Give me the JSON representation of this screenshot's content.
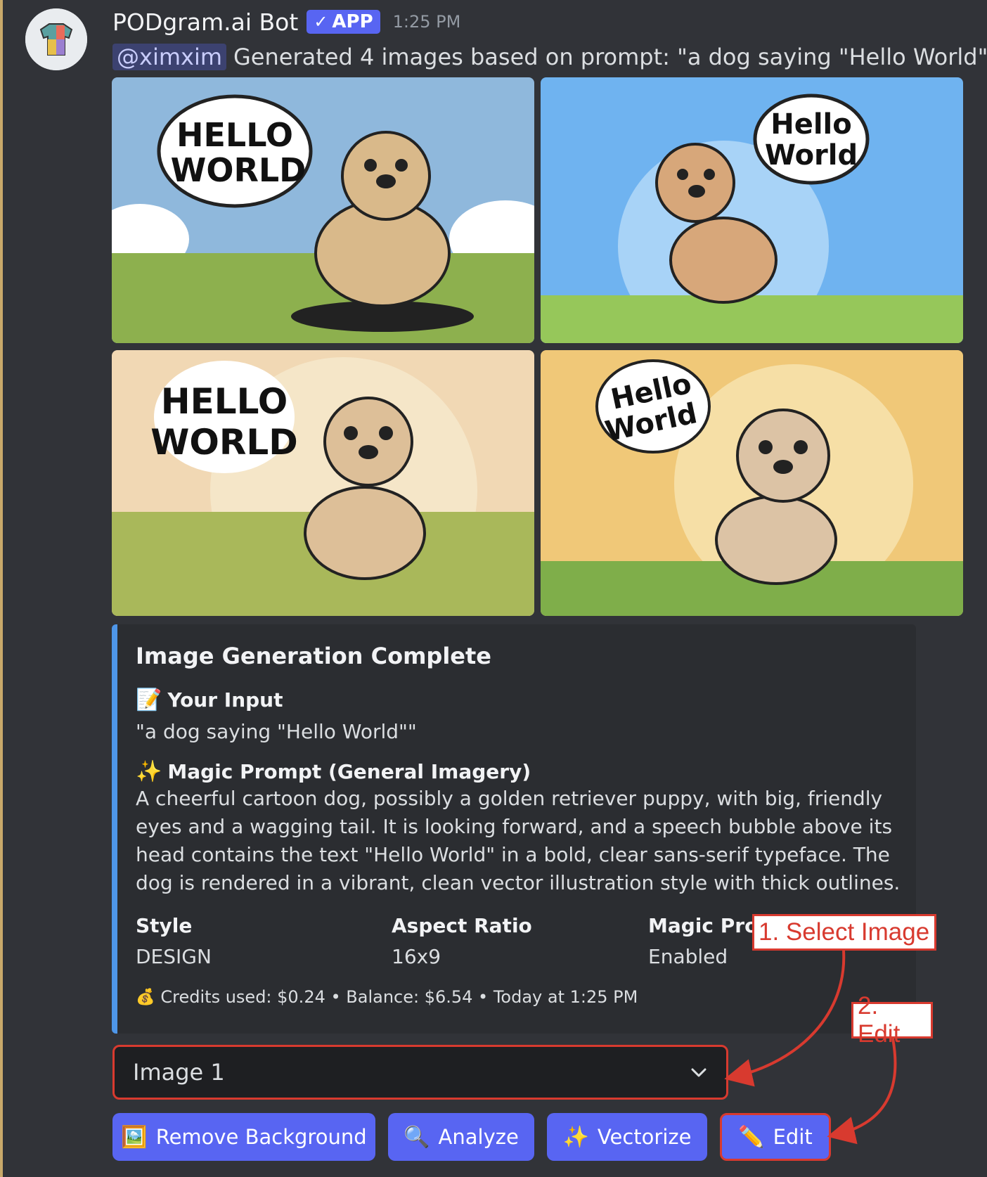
{
  "header": {
    "bot_name": "PODgram.ai Bot",
    "app_badge": "APP",
    "timestamp": "1:25 PM"
  },
  "message": {
    "mention": "@ximxim",
    "text": "Generated 4 images based on prompt: \"a dog saying \"Hello World\"\""
  },
  "images": [
    {
      "speech": [
        "HELLO",
        "WORLD"
      ],
      "bg": "#8fb8dc"
    },
    {
      "speech": [
        "Hello",
        "World"
      ],
      "bg": "#6fb3f0"
    },
    {
      "speech": [
        "HELLO",
        "WORLD"
      ],
      "bg": "#f1d8b4"
    },
    {
      "speech": [
        "Hello",
        "World"
      ],
      "bg": "#f0c878"
    }
  ],
  "embed": {
    "title": "Image Generation Complete",
    "input_emoji": "📝",
    "input_label": "Your Input",
    "input_value": "\"a dog saying \"Hello World\"\"",
    "magic_emoji": "✨",
    "magic_label": "Magic Prompt (General Imagery)",
    "magic_value": "A cheerful cartoon dog, possibly a golden retriever puppy, with big, friendly eyes and a wagging tail. It is looking forward, and a speech bubble above its head contains the text \"Hello World\" in a bold, clear sans-serif typeface. The dog is rendered in a vibrant, clean vector illustration style with thick outlines.",
    "fields": [
      {
        "name": "Style",
        "value": "DESIGN"
      },
      {
        "name": "Aspect Ratio",
        "value": "16x9"
      },
      {
        "name": "Magic Prompt",
        "value": "Enabled"
      }
    ],
    "footer_emoji": "💰",
    "footer": "Credits used: $0.24 • Balance: $6.54 • Today at 1:25 PM"
  },
  "select": {
    "value": "Image 1"
  },
  "buttons": {
    "remove_icon": "🖼️",
    "remove_label": "Remove Background",
    "analyze_icon": "🔍",
    "analyze_label": "Analyze",
    "vectorize_icon": "✨",
    "vectorize_label": "Vectorize",
    "edit_icon": "✏️",
    "edit_label": "Edit"
  },
  "annotations": {
    "step1": "1. Select Image",
    "step2": "2. Edit"
  },
  "colors": {
    "background": "#313338",
    "embed_bg": "#2b2d31",
    "embed_border": "#4e96e8",
    "button": "#5865f2",
    "annotation_red": "#d83a2f"
  }
}
